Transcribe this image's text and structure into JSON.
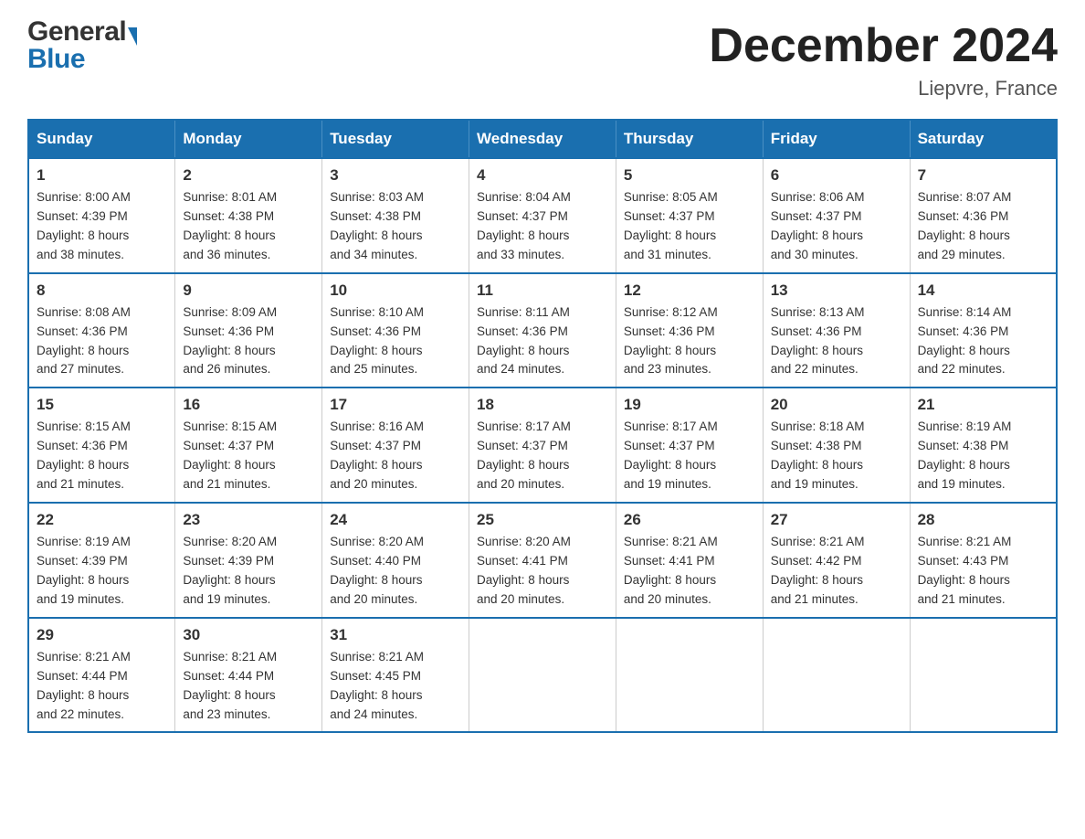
{
  "header": {
    "logo_line1": "General",
    "logo_line2": "Blue",
    "month_title": "December 2024",
    "location": "Liepvre, France"
  },
  "days_of_week": [
    "Sunday",
    "Monday",
    "Tuesday",
    "Wednesday",
    "Thursday",
    "Friday",
    "Saturday"
  ],
  "weeks": [
    [
      {
        "day": "1",
        "sunrise": "8:00 AM",
        "sunset": "4:39 PM",
        "daylight": "8 hours and 38 minutes."
      },
      {
        "day": "2",
        "sunrise": "8:01 AM",
        "sunset": "4:38 PM",
        "daylight": "8 hours and 36 minutes."
      },
      {
        "day": "3",
        "sunrise": "8:03 AM",
        "sunset": "4:38 PM",
        "daylight": "8 hours and 34 minutes."
      },
      {
        "day": "4",
        "sunrise": "8:04 AM",
        "sunset": "4:37 PM",
        "daylight": "8 hours and 33 minutes."
      },
      {
        "day": "5",
        "sunrise": "8:05 AM",
        "sunset": "4:37 PM",
        "daylight": "8 hours and 31 minutes."
      },
      {
        "day": "6",
        "sunrise": "8:06 AM",
        "sunset": "4:37 PM",
        "daylight": "8 hours and 30 minutes."
      },
      {
        "day": "7",
        "sunrise": "8:07 AM",
        "sunset": "4:36 PM",
        "daylight": "8 hours and 29 minutes."
      }
    ],
    [
      {
        "day": "8",
        "sunrise": "8:08 AM",
        "sunset": "4:36 PM",
        "daylight": "8 hours and 27 minutes."
      },
      {
        "day": "9",
        "sunrise": "8:09 AM",
        "sunset": "4:36 PM",
        "daylight": "8 hours and 26 minutes."
      },
      {
        "day": "10",
        "sunrise": "8:10 AM",
        "sunset": "4:36 PM",
        "daylight": "8 hours and 25 minutes."
      },
      {
        "day": "11",
        "sunrise": "8:11 AM",
        "sunset": "4:36 PM",
        "daylight": "8 hours and 24 minutes."
      },
      {
        "day": "12",
        "sunrise": "8:12 AM",
        "sunset": "4:36 PM",
        "daylight": "8 hours and 23 minutes."
      },
      {
        "day": "13",
        "sunrise": "8:13 AM",
        "sunset": "4:36 PM",
        "daylight": "8 hours and 22 minutes."
      },
      {
        "day": "14",
        "sunrise": "8:14 AM",
        "sunset": "4:36 PM",
        "daylight": "8 hours and 22 minutes."
      }
    ],
    [
      {
        "day": "15",
        "sunrise": "8:15 AM",
        "sunset": "4:36 PM",
        "daylight": "8 hours and 21 minutes."
      },
      {
        "day": "16",
        "sunrise": "8:15 AM",
        "sunset": "4:37 PM",
        "daylight": "8 hours and 21 minutes."
      },
      {
        "day": "17",
        "sunrise": "8:16 AM",
        "sunset": "4:37 PM",
        "daylight": "8 hours and 20 minutes."
      },
      {
        "day": "18",
        "sunrise": "8:17 AM",
        "sunset": "4:37 PM",
        "daylight": "8 hours and 20 minutes."
      },
      {
        "day": "19",
        "sunrise": "8:17 AM",
        "sunset": "4:37 PM",
        "daylight": "8 hours and 19 minutes."
      },
      {
        "day": "20",
        "sunrise": "8:18 AM",
        "sunset": "4:38 PM",
        "daylight": "8 hours and 19 minutes."
      },
      {
        "day": "21",
        "sunrise": "8:19 AM",
        "sunset": "4:38 PM",
        "daylight": "8 hours and 19 minutes."
      }
    ],
    [
      {
        "day": "22",
        "sunrise": "8:19 AM",
        "sunset": "4:39 PM",
        "daylight": "8 hours and 19 minutes."
      },
      {
        "day": "23",
        "sunrise": "8:20 AM",
        "sunset": "4:39 PM",
        "daylight": "8 hours and 19 minutes."
      },
      {
        "day": "24",
        "sunrise": "8:20 AM",
        "sunset": "4:40 PM",
        "daylight": "8 hours and 20 minutes."
      },
      {
        "day": "25",
        "sunrise": "8:20 AM",
        "sunset": "4:41 PM",
        "daylight": "8 hours and 20 minutes."
      },
      {
        "day": "26",
        "sunrise": "8:21 AM",
        "sunset": "4:41 PM",
        "daylight": "8 hours and 20 minutes."
      },
      {
        "day": "27",
        "sunrise": "8:21 AM",
        "sunset": "4:42 PM",
        "daylight": "8 hours and 21 minutes."
      },
      {
        "day": "28",
        "sunrise": "8:21 AM",
        "sunset": "4:43 PM",
        "daylight": "8 hours and 21 minutes."
      }
    ],
    [
      {
        "day": "29",
        "sunrise": "8:21 AM",
        "sunset": "4:44 PM",
        "daylight": "8 hours and 22 minutes."
      },
      {
        "day": "30",
        "sunrise": "8:21 AM",
        "sunset": "4:44 PM",
        "daylight": "8 hours and 23 minutes."
      },
      {
        "day": "31",
        "sunrise": "8:21 AM",
        "sunset": "4:45 PM",
        "daylight": "8 hours and 24 minutes."
      },
      null,
      null,
      null,
      null
    ]
  ],
  "labels": {
    "sunrise": "Sunrise:",
    "sunset": "Sunset:",
    "daylight": "Daylight:"
  }
}
